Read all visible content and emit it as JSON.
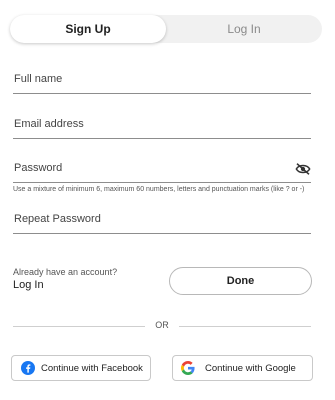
{
  "tabs": {
    "signup": "Sign Up",
    "login": "Log In"
  },
  "form": {
    "full_name": "Full name",
    "email": "Email address",
    "password": "Password",
    "password_hint": "Use a mixture of minimum 6, maximum 60 numbers, letters and punctuation marks (like ? or -)",
    "repeat_password": "Repeat Password"
  },
  "account": {
    "already": "Already have an account?",
    "login_link": "Log In",
    "done": "Done"
  },
  "divider": "OR",
  "social": {
    "facebook": "Continue with Facebook",
    "google": "Continue with Google"
  },
  "icons": {
    "password_toggle": "eye-off-icon",
    "facebook": "facebook-icon",
    "google": "google-icon"
  },
  "colors": {
    "facebook": "#1877F2",
    "google_blue": "#4285F4",
    "google_red": "#EA4335",
    "google_yellow": "#FBBC05",
    "google_green": "#34A853"
  }
}
